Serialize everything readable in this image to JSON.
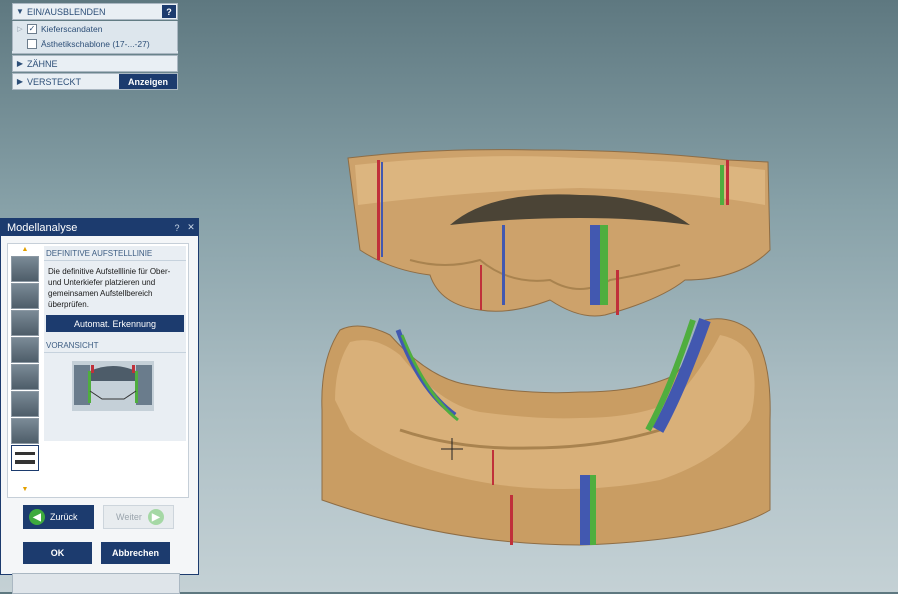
{
  "visibility_panel": {
    "header": "EIN/AUSBLENDEN",
    "help": "?",
    "items": [
      {
        "label": "Kieferscandaten",
        "checked": true
      },
      {
        "label": "Ästhetikschablone (17-...-27)",
        "checked": false
      }
    ],
    "teeth_label": "ZÄHNE",
    "hidden_label": "VERSTECKT",
    "show_button": "Anzeigen"
  },
  "dialog": {
    "title": "Modellanalyse",
    "help": "?",
    "close": "✕",
    "section_title": "DEFINITIVE AUFSTELLLINIE",
    "description": "Die definitive Aufstelllinie für Ober- und Unterkiefer platzieren und gemeinsamen Aufstellbereich überprüfen.",
    "auto_detect_button": "Automat. Erkennung",
    "preview_title": "VORANSICHT",
    "back_button": "Zurück",
    "next_button": "Weiter",
    "ok_button": "OK",
    "cancel_button": "Abbrechen"
  },
  "colors": {
    "accent": "#1c3b6e",
    "model": "#d2aa72",
    "line_red": "#c0303a",
    "line_blue": "#4258b0",
    "line_green": "#4fae3e"
  }
}
